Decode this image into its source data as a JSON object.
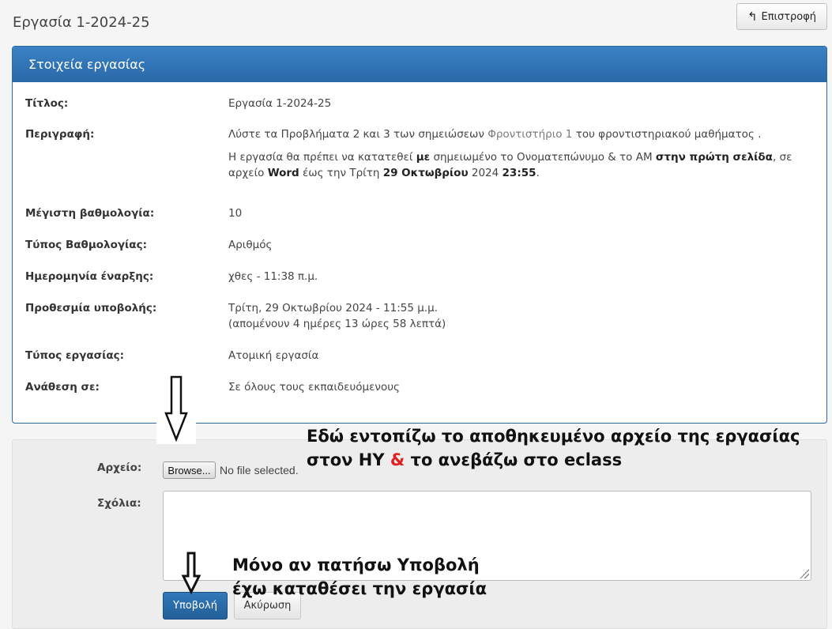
{
  "header": {
    "title": "Εργασία 1-2024-25",
    "back_label": "Επιστροφή"
  },
  "panel": {
    "title": "Στοιχεία εργασίας",
    "rows": {
      "title_label": "Τίτλος:",
      "title_value": "Εργασία 1-2024-25",
      "desc_label": "Περιγραφή:",
      "desc_line1_pre": "Λύστε τα Προβλήματα 2 και 3 των σημειώσεων ",
      "desc_line1_link": "Φροντιστήριο 1",
      "desc_line1_post": " του φροντιστηριακού μαθήματος .",
      "desc_p2_a": "Η εργασία θα πρέπει να κατατεθεί ",
      "desc_p2_b": "με",
      "desc_p2_c": " σημειωμένο το Ονοματεπώνυμο & το ΑΜ ",
      "desc_p2_d": "στην πρώτη σελίδα",
      "desc_p2_e": ", σε αρχείο ",
      "desc_p2_f": "Word",
      "desc_p2_g": " έως την Τρίτη ",
      "desc_p2_h": "29 Οκτωβρίου",
      "desc_p2_i": " 2024 ",
      "desc_p2_j": "23:55",
      "desc_p2_k": ".",
      "max_label": "Μέγιστη βαθμολογία:",
      "max_value": "10",
      "gtype_label": "Τύπος Βαθμολογίας:",
      "gtype_value": "Αριθμός",
      "start_label": "Ημερομηνία έναρξης:",
      "start_value": "χθες - 11:38 π.μ.",
      "deadline_label": "Προθεσμία υποβολής:",
      "deadline_value": "Τρίτη, 29 Οκτωβρίου 2024 - 11:55 μ.μ.",
      "deadline_remaining": "(απομένουν 4 ημέρες 13 ώρες 58 λεπτά)",
      "atype_label": "Τύπος εργασίας:",
      "atype_value": "Ατομική εργασία",
      "assign_label": "Ανάθεση σε:",
      "assign_value": "Σε όλους τους εκπαιδευόμενους"
    }
  },
  "form": {
    "file_label": "Αρχείο:",
    "browse_label": "Browse...",
    "no_file": "No file selected.",
    "comments_label": "Σχόλια:",
    "comments_value": "",
    "submit_label": "Υποβολή",
    "cancel_label": "Ακύρωση"
  },
  "annotations": {
    "upload_line1": "Εδώ εντοπίζω το αποθηκευμένο αρχείο της εργασίας",
    "upload_line2_a": "στον ΗΥ ",
    "upload_line2_amp": "&",
    "upload_line2_b": " το ανεβάζω στο eclass",
    "submit_line1": "Μόνο αν πατήσω Υποβολή",
    "submit_line2": "έχω καταθέσει την εργασία",
    "accent_color": "#e02020"
  }
}
